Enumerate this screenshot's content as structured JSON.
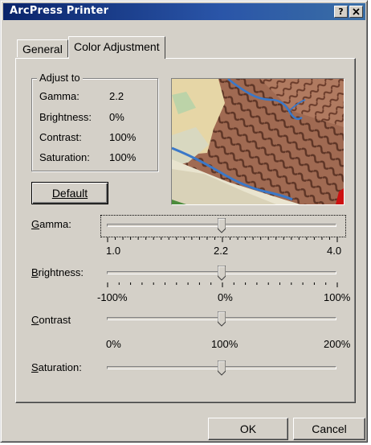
{
  "window": {
    "title": "ArcPress Printer",
    "help_button": "?",
    "close_button": "✕"
  },
  "tabs": [
    {
      "label": "General",
      "active": false
    },
    {
      "label": "Color Adjustment",
      "active": true
    }
  ],
  "adjust_group": {
    "title": "Adjust to",
    "rows": [
      {
        "label": "Gamma:",
        "value": "2.2"
      },
      {
        "label": "Brightness:",
        "value": "0%"
      },
      {
        "label": "Contrast:",
        "value": "100%"
      },
      {
        "label": "Saturation:",
        "value": "100%"
      }
    ]
  },
  "default_button": "Default",
  "sliders": {
    "gamma": {
      "label": "Gamma:",
      "mnemonic": "G",
      "rest": "amma:",
      "min": "1.0",
      "mid": "2.2",
      "max": "4.0",
      "level": 0.5
    },
    "brightness": {
      "label": "Brightness:",
      "mnemonic": "B",
      "rest": "rightness:",
      "min": "-100%",
      "mid": "0%",
      "max": "100%",
      "level": 0.5
    },
    "contrast": {
      "label": "Contrast",
      "mnemonic": "C",
      "rest": "ontrast",
      "min": "0%",
      "mid": "100%",
      "max": "200%",
      "level": 0.5
    },
    "saturation": {
      "label": "Saturation:",
      "mnemonic": "S",
      "rest": "aturation:",
      "level": 0.5
    }
  },
  "footer": {
    "ok": "OK",
    "cancel": "Cancel"
  },
  "colors": {
    "title_bar": "#0a246a",
    "face": "#d4d0c8",
    "map_relief": "#8a5a44",
    "map_river": "#3a78c8"
  },
  "icons": {
    "preview": "terrain-map-preview"
  }
}
